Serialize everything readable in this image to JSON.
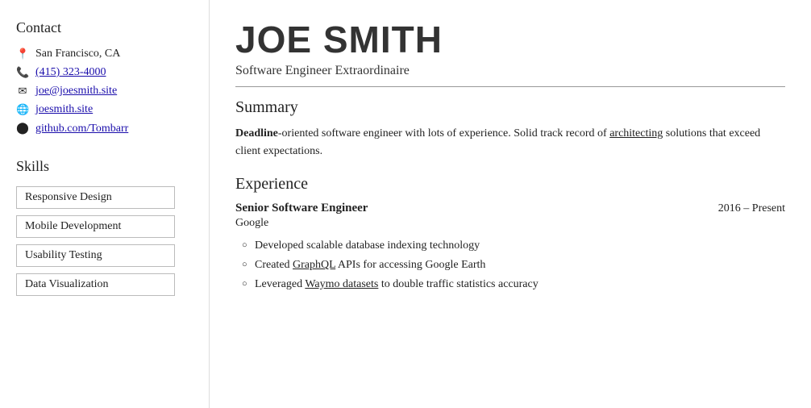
{
  "sidebar": {
    "contact_heading": "Contact",
    "contact_items": [
      {
        "icon": "📍",
        "icon_name": "location-icon",
        "text": "San Francisco, CA",
        "link": false
      },
      {
        "icon": "📞",
        "icon_name": "phone-icon",
        "text": "(415) 323-4000",
        "link": true
      },
      {
        "icon": "✉",
        "icon_name": "email-icon",
        "text": "joe@joesmith.site",
        "link": true
      },
      {
        "icon": "🌐",
        "icon_name": "globe-icon",
        "text": "joesmith.site",
        "link": true
      },
      {
        "icon": "⬡",
        "icon_name": "github-icon",
        "text": "github.com/Tombarr",
        "link": true
      }
    ],
    "skills_heading": "Skills",
    "skills": [
      "Responsive Design",
      "Mobile Development",
      "Usability Testing",
      "Data Visualization"
    ]
  },
  "main": {
    "name": "JOE SMITH",
    "subtitle": "Software Engineer Extraordinaire",
    "summary_heading": "Summary",
    "summary_text_part1": "Deadline",
    "summary_text_part2": "-oriented software engineer with lots of experience. Solid track record of ",
    "summary_underline": "architecting",
    "summary_text_part3": " solutions that exceed client expectations.",
    "experience_heading": "Experience",
    "jobs": [
      {
        "title": "Senior Software Engineer",
        "dates": "2016 – Present",
        "company": "Google",
        "bullets": [
          "Developed scalable database indexing technology",
          "Created GraphQL APIs for accessing Google Earth",
          "Leveraged Waymo datasets to double traffic statistics accuracy"
        ],
        "underline_words": [
          "GraphQL",
          "Waymo datasets"
        ]
      }
    ]
  }
}
